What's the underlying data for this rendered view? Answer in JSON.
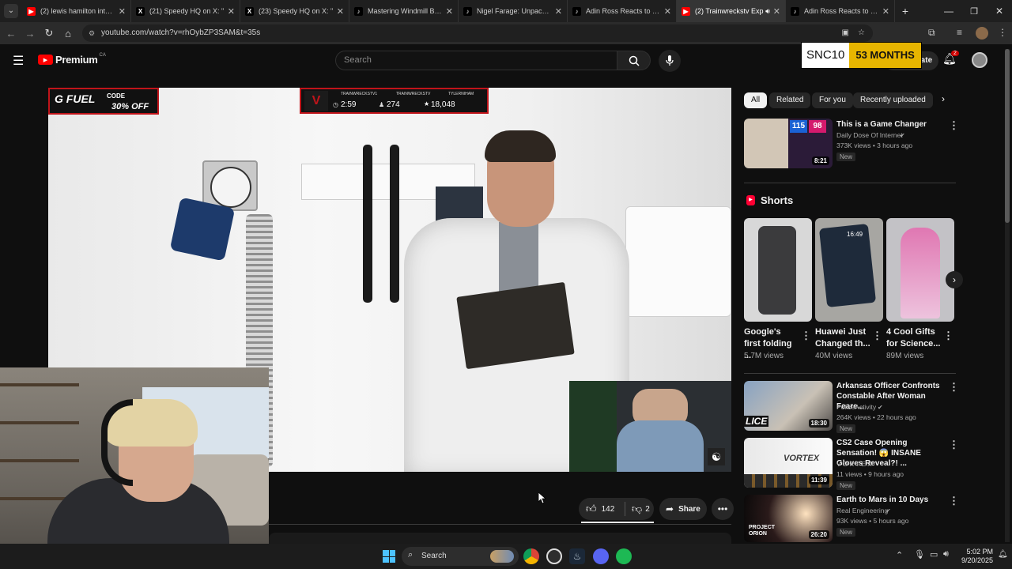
{
  "tabs": [
    {
      "label": "(2) lewis hamilton intervie",
      "favicon": "youtube-icon"
    },
    {
      "label": "(21) Speedy HQ on X: \"",
      "favicon": "x-icon"
    },
    {
      "label": "(23) Speedy HQ on X: \"",
      "favicon": "x-icon"
    },
    {
      "label": "Mastering Windmill Break",
      "favicon": "tiktok-icon"
    },
    {
      "label": "Nigel Farage: Unpacking",
      "favicon": "tiktok-icon"
    },
    {
      "label": "Adin Ross Reacts to Indu",
      "favicon": "tiktok-icon"
    },
    {
      "label": "(2) Trainwreckstv Exp",
      "favicon": "youtube-icon",
      "active": true
    },
    {
      "label": "Adin Ross Reacts to Indu",
      "favicon": "tiktok-icon"
    }
  ],
  "address": {
    "url": "youtube.com/watch?v=rhOybZP3SAM&t=35s"
  },
  "youtube": {
    "logo_text": "Premium",
    "region": "CA",
    "search_placeholder": "Search",
    "create_label": "Create",
    "notifications_count": "2"
  },
  "overlay": {
    "sub_badge_left": "SNC10",
    "sub_badge_right": "53 MONTHS",
    "gfuel_brand": "G FUEL",
    "gfuel_code_label": "CODE",
    "gfuel_offer": "30% OFF",
    "stream_handle_1": "TRAINWRECKSTV1",
    "stream_handle_2": "TRAINWRECKSTV",
    "stream_handle_3": "TYLERNIHAM",
    "stream_time": "2:59",
    "stream_viewers": "274",
    "stream_followers": "18,048"
  },
  "actions": {
    "likes": "142",
    "dislikes": "2",
    "share_label": "Share"
  },
  "chips": [
    {
      "label": "All",
      "selected": true
    },
    {
      "label": "Related"
    },
    {
      "label": "For you"
    },
    {
      "label": "Recently uploaded"
    }
  ],
  "recommendations": [
    {
      "title": "This is a Game Changer",
      "channel": "Daily Dose Of Internet",
      "meta": "373K views • 3 hours ago",
      "duration": "8:21",
      "new": "New"
    },
    {
      "title": "Arkansas Officer Confronts Constable After Woman Feare...",
      "channel": "PoliceActivity",
      "meta": "264K views • 22 hours ago",
      "duration": "18:30",
      "new": "New"
    },
    {
      "title": "CS2 Case Opening Sensation! 😱 INSANE Gloves Reveal?! ...",
      "channel": "VORTEX",
      "meta": "11 views • 9 hours ago",
      "duration": "11:39",
      "new": "New"
    },
    {
      "title": "Earth to Mars in 10 Days",
      "channel": "Real Engineering",
      "meta": "93K views • 5 hours ago",
      "duration": "26:20",
      "new": "New"
    }
  ],
  "shorts_heading": "Shorts",
  "shorts": [
    {
      "title": "Google's first folding ...",
      "views": "5.7M views"
    },
    {
      "title": "Huawei Just Changed th...",
      "views": "40M views"
    },
    {
      "title": "4 Cool Gifts for Science...",
      "views": "89M views"
    }
  ],
  "thumb_text": {
    "game_changer_scores": [
      "115",
      "98"
    ],
    "vortex_label": "VORTEX",
    "project_orion": "PROJECT ORION",
    "police_text": "LICE",
    "huawei_time": "16:49"
  },
  "taskbar": {
    "search_label": "Search",
    "time": "5:02 PM",
    "date": "9/20/2025"
  },
  "colors": {
    "accent": "#ff0000",
    "badge_gold": "#e7b500"
  }
}
